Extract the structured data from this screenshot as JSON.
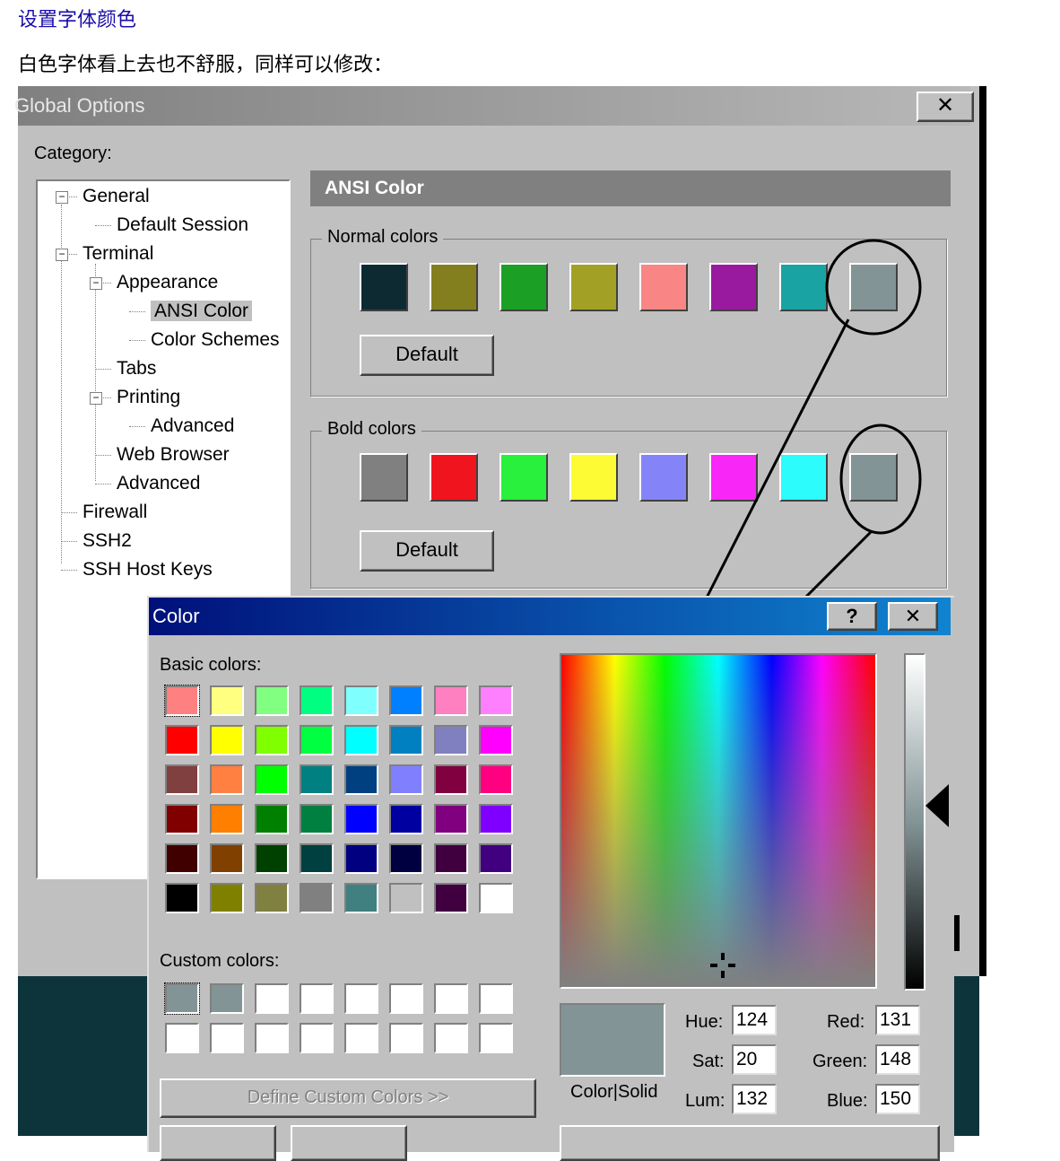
{
  "doc": {
    "title": "设置字体颜色",
    "paragraph": "白色字体看上去也不舒服，同样可以修改："
  },
  "global_options": {
    "title": "Global Options",
    "close_label": "✕",
    "category_label": "Category:",
    "tree": [
      {
        "label": "General",
        "expander": "−"
      },
      {
        "label": "Default Session"
      },
      {
        "label": "Terminal",
        "expander": "−"
      },
      {
        "label": "Appearance",
        "expander": "−"
      },
      {
        "label": "ANSI Color",
        "selected": true
      },
      {
        "label": "Color Schemes"
      },
      {
        "label": "Tabs"
      },
      {
        "label": "Printing",
        "expander": "−"
      },
      {
        "label": "Advanced"
      },
      {
        "label": "Web Browser"
      },
      {
        "label": "Advanced"
      },
      {
        "label": "Firewall"
      },
      {
        "label": "SSH2"
      },
      {
        "label": "SSH Host Keys"
      }
    ],
    "section_title": "ANSI Color",
    "normal_colors": {
      "label": "Normal colors",
      "default_button": "Default",
      "swatches": [
        "#0d2a33",
        "#847f1e",
        "#1c9f25",
        "#a3a125",
        "#f98684",
        "#9a1a9f",
        "#1aa3a3",
        "#839496"
      ]
    },
    "bold_colors": {
      "label": "Bold colors",
      "default_button": "Default",
      "swatches": [
        "#808080",
        "#f0141e",
        "#28f03c",
        "#fdfb33",
        "#8484f8",
        "#f826f6",
        "#2cfcfc",
        "#839496"
      ]
    }
  },
  "color_dialog": {
    "title": "Color",
    "help_label": "?",
    "close_label": "✕",
    "basic_colors_label": "Basic colors:",
    "basic_colors": [
      [
        "#ff8080",
        "#ffff80",
        "#80ff80",
        "#00ff80",
        "#80ffff",
        "#0080ff",
        "#ff80c0",
        "#ff80ff"
      ],
      [
        "#ff0000",
        "#ffff00",
        "#80ff00",
        "#00ff40",
        "#00ffff",
        "#0080c0",
        "#8080c0",
        "#ff00ff"
      ],
      [
        "#804040",
        "#ff8040",
        "#00ff00",
        "#008080",
        "#004080",
        "#8080ff",
        "#800040",
        "#ff0080"
      ],
      [
        "#800000",
        "#ff8000",
        "#008000",
        "#008040",
        "#0000ff",
        "#0000a0",
        "#800080",
        "#8000ff"
      ],
      [
        "#400000",
        "#804000",
        "#004000",
        "#004040",
        "#000080",
        "#000040",
        "#400040",
        "#400080"
      ],
      [
        "#000000",
        "#808000",
        "#808040",
        "#808080",
        "#408080",
        "#c0c0c0",
        "#400040",
        "#ffffff"
      ]
    ],
    "custom_colors_label": "Custom colors:",
    "custom_colors": [
      [
        "#839496",
        "#839496",
        "#ffffff",
        "#ffffff",
        "#ffffff",
        "#ffffff",
        "#ffffff",
        "#ffffff"
      ],
      [
        "#ffffff",
        "#ffffff",
        "#ffffff",
        "#ffffff",
        "#ffffff",
        "#ffffff",
        "#ffffff",
        "#ffffff"
      ]
    ],
    "define_custom_button": "Define Custom Colors >>",
    "preview_label": "Color|Solid",
    "preview_color": "#839496",
    "hue_label": "Hue:",
    "hue": "124",
    "sat_label": "Sat:",
    "sat": "20",
    "lum_label": "Lum:",
    "lum": "132",
    "red_label": "Red:",
    "red": "131",
    "green_label": "Green:",
    "green": "148",
    "blue_label": "Blue:",
    "blue": "150"
  }
}
